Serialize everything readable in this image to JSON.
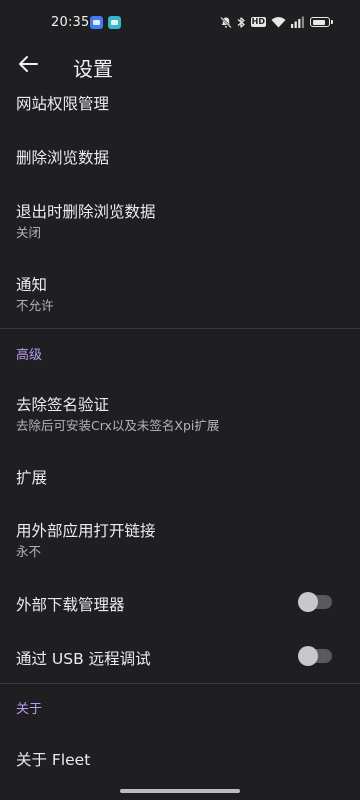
{
  "status_bar": {
    "time": "20:35",
    "hd_label": "HD",
    "battery_level": 0.85,
    "icons": [
      "app-badge-icon",
      "app-badge-icon",
      "mute-icon",
      "bluetooth-icon",
      "hd-icon",
      "wifi-icon",
      "signal-icon",
      "battery-icon"
    ]
  },
  "app_bar": {
    "title": "设置",
    "back_icon": "arrow-left-icon"
  },
  "items": [
    {
      "title": "网站权限管理"
    },
    {
      "title": "删除浏览数据"
    },
    {
      "title": "退出时删除浏览数据",
      "subtitle": "关闭"
    },
    {
      "title": "通知",
      "subtitle": "不允许"
    }
  ],
  "advanced": {
    "header": "高级",
    "items": [
      {
        "title": "去除签名验证",
        "subtitle": "去除后可安装Crx以及未签名Xpi扩展"
      },
      {
        "title": "扩展"
      },
      {
        "title": "用外部应用打开链接",
        "subtitle": "永不"
      },
      {
        "title": "外部下载管理器",
        "switch_on": false
      },
      {
        "title": "通过 USB 远程调试",
        "switch_on": false
      }
    ]
  },
  "about": {
    "header": "关于",
    "items": [
      {
        "title": "关于 Fleet"
      }
    ]
  },
  "colors": {
    "background": "#1f1f22",
    "accent": "#b79cf0",
    "text": "#ececef",
    "subtext": "#b4b4b8"
  }
}
